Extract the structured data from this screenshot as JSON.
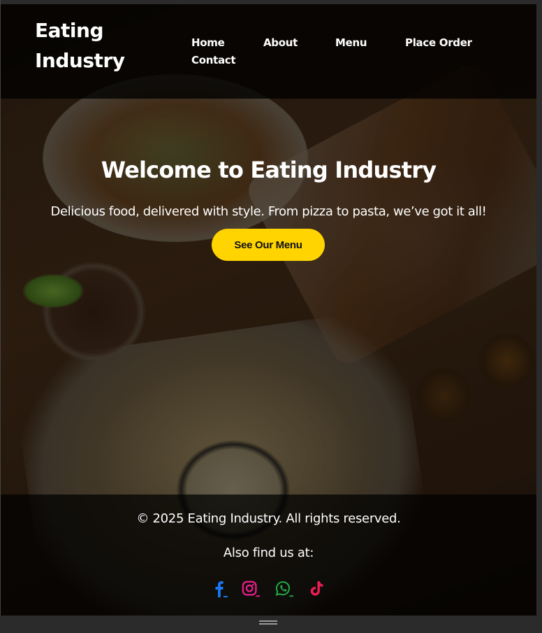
{
  "brand": {
    "line1": "Eating",
    "line2": "Industry"
  },
  "nav": {
    "items": [
      {
        "label": "Home"
      },
      {
        "label": "About"
      },
      {
        "label": "Menu"
      },
      {
        "label": "Place Order"
      },
      {
        "label": "Contact"
      }
    ]
  },
  "hero": {
    "title": "Welcome to Eating Industry",
    "subtitle": "Delicious food, delivered with style. From pizza to pasta, we’ve got it all!",
    "cta_label": "See Our Menu"
  },
  "footer": {
    "copyright": "© 2025 Eating Industry. All rights reserved.",
    "find_us": "Also find us at:",
    "social": [
      {
        "icon": "facebook-icon",
        "color": "#1877f2"
      },
      {
        "icon": "instagram-icon",
        "color": "#e1306c"
      },
      {
        "icon": "whatsapp-icon",
        "color": "#25d366"
      },
      {
        "icon": "tiktok-icon",
        "color": "#ee1d52"
      }
    ]
  },
  "colors": {
    "accent": "#ffd400",
    "navbar_bg": "#000000"
  }
}
